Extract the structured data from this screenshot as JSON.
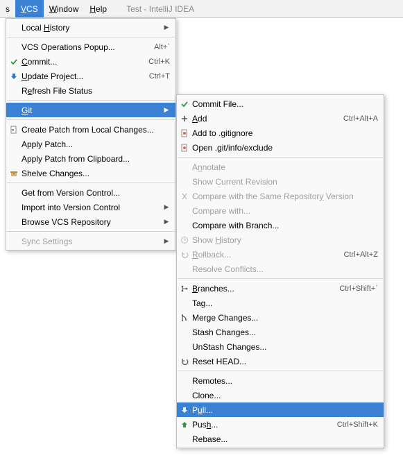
{
  "menubar": {
    "left_cut": "s",
    "vcs": "VCS",
    "window": "Window",
    "help": "Help",
    "title": "Test - IntelliJ IDEA"
  },
  "main_menu": {
    "local_history": "Local History",
    "vcs_ops_popup": "VCS Operations Popup...",
    "vcs_ops_popup_sc": "Alt+`",
    "commit": "Commit...",
    "commit_sc": "Ctrl+K",
    "update_project": "Update Project...",
    "update_project_sc": "Ctrl+T",
    "refresh": "Refresh File Status",
    "git": "Git",
    "create_patch": "Create Patch from Local Changes...",
    "apply_patch": "Apply Patch...",
    "apply_patch_clip": "Apply Patch from Clipboard...",
    "shelve": "Shelve Changes...",
    "get_vc": "Get from Version Control...",
    "import_vc": "Import into Version Control",
    "browse_repo": "Browse VCS Repository",
    "sync": "Sync Settings"
  },
  "git_menu": {
    "commit_file": "Commit File...",
    "add": "Add",
    "add_sc": "Ctrl+Alt+A",
    "add_gitignore": "Add to .gitignore",
    "open_exclude": "Open .git/info/exclude",
    "annotate": "Annotate",
    "show_revision": "Show Current Revision",
    "compare_same": "Compare with the Same Repository Version",
    "compare_with": "Compare with...",
    "compare_branch": "Compare with Branch...",
    "show_history": "Show History",
    "rollback": "Rollback...",
    "rollback_sc": "Ctrl+Alt+Z",
    "resolve": "Resolve Conflicts...",
    "branches": "Branches...",
    "branches_sc": "Ctrl+Shift+`",
    "tag": "Tag...",
    "merge": "Merge Changes...",
    "stash": "Stash Changes...",
    "unstash": "UnStash Changes...",
    "reset_head": "Reset HEAD...",
    "remotes": "Remotes...",
    "clone": "Clone...",
    "pull": "Pull...",
    "push": "Push...",
    "push_sc": "Ctrl+Shift+K",
    "rebase": "Rebase..."
  }
}
